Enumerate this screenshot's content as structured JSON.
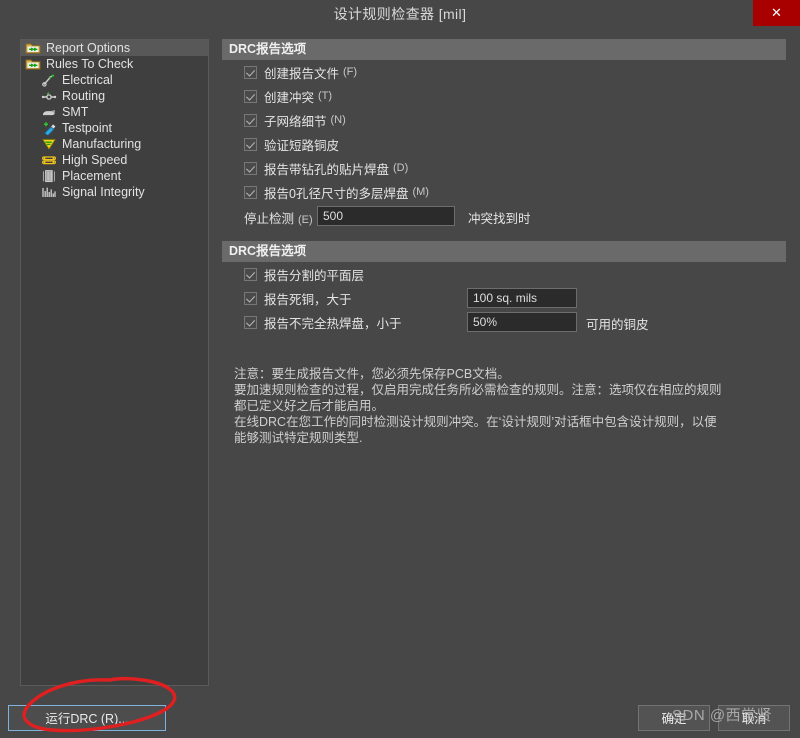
{
  "window": {
    "title": "设计规则检查器 [mil]",
    "close_label": "✕",
    "accent_close": "#a80000",
    "bg": "#474747"
  },
  "sidebar": {
    "items": [
      {
        "label": "Report Options",
        "icon": "folder-arrows-icon",
        "level": 0,
        "selected": true
      },
      {
        "label": "Rules To Check",
        "icon": "folder-arrows-icon",
        "level": 0,
        "selected": false
      },
      {
        "label": "Electrical",
        "icon": "electrical-icon",
        "level": 1,
        "selected": false
      },
      {
        "label": "Routing",
        "icon": "routing-icon",
        "level": 1,
        "selected": false
      },
      {
        "label": "SMT",
        "icon": "smt-icon",
        "level": 1,
        "selected": false
      },
      {
        "label": "Testpoint",
        "icon": "testpoint-icon",
        "level": 1,
        "selected": false
      },
      {
        "label": "Manufacturing",
        "icon": "manufacturing-icon",
        "level": 1,
        "selected": false
      },
      {
        "label": "High Speed",
        "icon": "high-speed-icon",
        "level": 1,
        "selected": false
      },
      {
        "label": "Placement",
        "icon": "placement-icon",
        "level": 1,
        "selected": false
      },
      {
        "label": "Signal Integrity",
        "icon": "signal-integrity-icon",
        "level": 1,
        "selected": false
      }
    ]
  },
  "group1": {
    "header": "DRC报告选项",
    "options": [
      {
        "label": "创建报告文件",
        "accel": "(F)",
        "checked": true
      },
      {
        "label": "创建冲突",
        "accel": "(T)",
        "checked": true
      },
      {
        "label": "子网络细节",
        "accel": "(N)",
        "checked": true
      },
      {
        "label": "验证短路铜皮",
        "accel": "",
        "checked": true
      },
      {
        "label": "报告带钻孔的贴片焊盘",
        "accel": "(D)",
        "checked": true
      },
      {
        "label": "报告0孔径尺寸的多层焊盘",
        "accel": "(M)",
        "checked": true
      }
    ],
    "stop_check": {
      "label": "停止检测",
      "accel": "(E)",
      "value": "500",
      "tail": "冲突找到时"
    }
  },
  "group2": {
    "header": "DRC报告选项",
    "options": [
      {
        "label": "报告分割的平面层",
        "checked": true,
        "value": null,
        "tail": null
      },
      {
        "label": "报告死铜，大于",
        "checked": true,
        "value": "100 sq. mils",
        "tail": null
      },
      {
        "label": "报告不完全热焊盘，小于",
        "checked": true,
        "value": "50%",
        "tail": "可用的铜皮"
      }
    ]
  },
  "note": {
    "text": "注意：要生成报告文件，您必须先保存PCB文档。\n要加速规则检查的过程，仅启用完成任务所必需检查的规则。注意：选项仅在相应的规则\n都已定义好之后才能启用。\n在线DRC在您工作的同时检测设计规则冲突。在‘设计规则’对话框中包含设计规则，以便\n能够测试特定规则类型."
  },
  "footer": {
    "run_label": "运行DRC (R)...",
    "ok_label": "确定",
    "cancel_label": "取消"
  },
  "watermark": {
    "text": "SDN @西常贤",
    "color": "#b9b9b9"
  },
  "annotation": {
    "shape": "red-ellipse-highlight",
    "color": "#e02020",
    "target": "run-drc-button"
  }
}
